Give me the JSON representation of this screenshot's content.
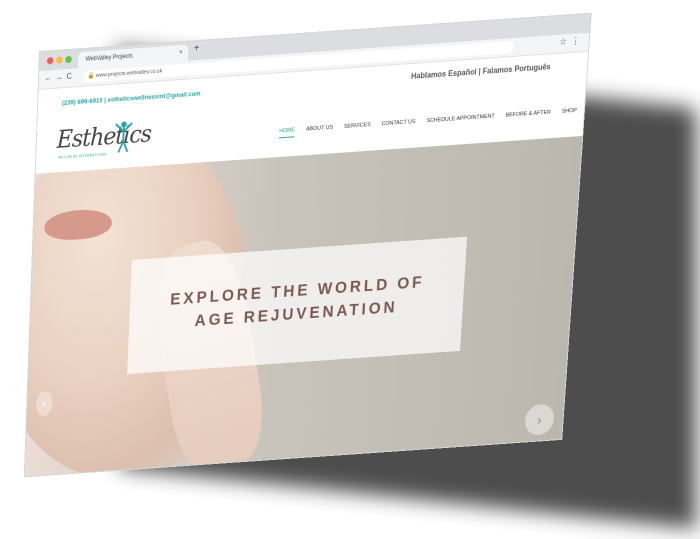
{
  "browser": {
    "tab_title": "WebValley Projects",
    "tab_close": "×",
    "new_tab": "+",
    "back": "←",
    "forward": "→",
    "reload": "C",
    "url": "www.projects.webvalley.co.uk",
    "star": "☆",
    "menu": "⋮"
  },
  "site": {
    "contact": "(239) 699-6910 | estheticswellnessint@gmail.com",
    "languages": "Hablamos Español | Falamos Português",
    "logo_text": "Esthetics",
    "logo_tagline": "WELLNESS INTERNATIONAL",
    "nav": [
      {
        "label": "HOME"
      },
      {
        "label": "ABOUT US"
      },
      {
        "label": "SERVICES"
      },
      {
        "label": "CONTACT US"
      },
      {
        "label": "SCHEDULE APPOINTMENT"
      },
      {
        "label": "BEFORE & AFTER"
      },
      {
        "label": "SHOP"
      }
    ],
    "active_nav": "HOME",
    "hero": {
      "line1": "EXPLORE THE WORLD OF",
      "line2": "AGE REJUVENATION",
      "prev": "‹",
      "next": "›"
    }
  },
  "colors": {
    "accent": "#2aa6a0",
    "hero_text": "#7a5a52"
  }
}
